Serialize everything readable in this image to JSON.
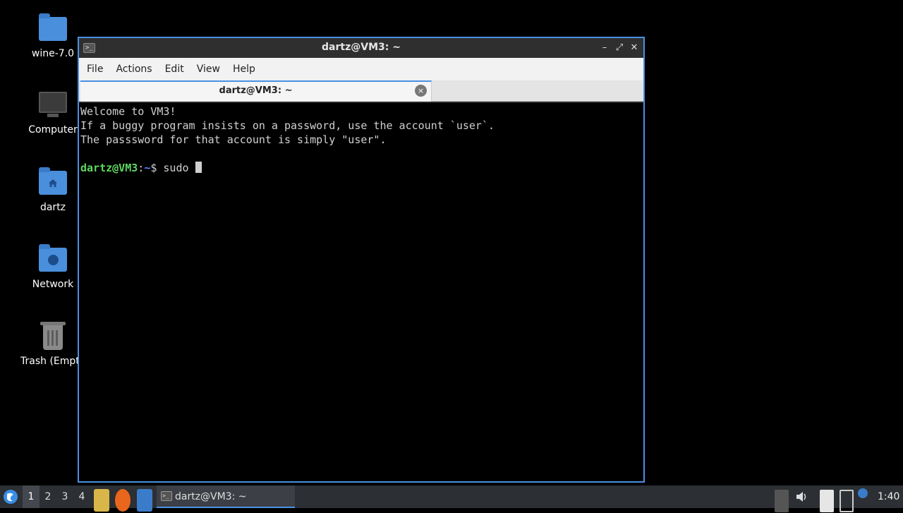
{
  "desktop": {
    "icons": [
      {
        "label": "wine-7.0",
        "icon": "folder-icon"
      },
      {
        "label": "Computer",
        "icon": "computer-icon"
      },
      {
        "label": "dartz",
        "icon": "home-folder-icon"
      },
      {
        "label": "Network",
        "icon": "network-folder-icon"
      },
      {
        "label": "Trash (Empty)",
        "icon": "trash-icon"
      }
    ]
  },
  "window": {
    "title": "dartz@VM3: ~",
    "icon": "terminal-icon",
    "controls": {
      "minimize": "–",
      "maximize": "⤢",
      "close": "✕"
    },
    "menu": [
      "File",
      "Actions",
      "Edit",
      "View",
      "Help"
    ],
    "tab": {
      "label": "dartz@VM3: ~",
      "close": "×"
    },
    "terminal": {
      "lines": [
        "Welcome to VM3!",
        "If a buggy program insists on a password, use the account `user`.",
        "The passsword for that account is simply \"user\"."
      ],
      "prompt_user": "dartz@VM3",
      "prompt_sep": ":",
      "prompt_path": "~",
      "prompt_symbol": "$",
      "command": "sudo "
    }
  },
  "taskbar": {
    "start_icon": "lxqt-start-icon",
    "workspaces": [
      "1",
      "2",
      "3",
      "4"
    ],
    "active_workspace": "1",
    "quicklaunch": [
      "file-manager-icon",
      "firefox-icon",
      "show-desktop-icon"
    ],
    "task": {
      "label": "dartz@VM3: ~",
      "icon": "terminal-icon"
    },
    "tray": [
      "tray-expand-icon",
      "volume-icon",
      "clipboard-icon",
      "network-icon",
      "update-notifier-icon"
    ],
    "clock": "1:40"
  },
  "colors": {
    "accent": "#4a90e2",
    "prompt_user": "#5fd75f",
    "prompt_path": "#5f87ff"
  }
}
